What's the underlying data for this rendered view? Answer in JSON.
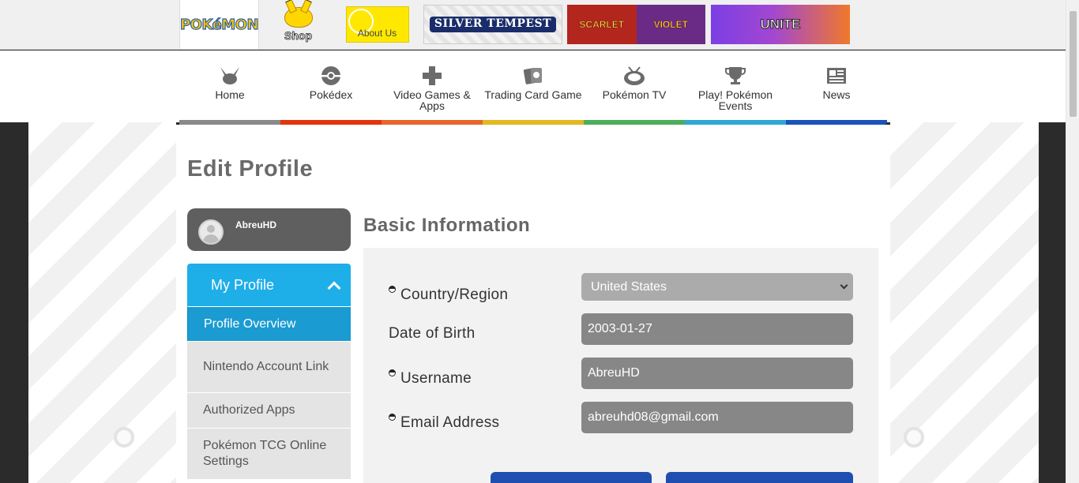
{
  "brand_bar": {
    "pokemon_logo": "POKéMON",
    "shop_label": "Shop",
    "about_label": "About Us",
    "banners": {
      "silver_tempest": "SILVER TEMPEST",
      "scarlet": "SCARLET",
      "violet": "VIOLET",
      "unite": "UNITE"
    }
  },
  "nav": {
    "items": [
      {
        "label": "Home",
        "icon": "pikachu-ears-icon",
        "color": "#8a8a8a"
      },
      {
        "label": "Pokédex",
        "icon": "pokeball-icon",
        "color": "#e3350d"
      },
      {
        "label": "Video Games & Apps",
        "icon": "dpad-icon",
        "color": "#e6672d"
      },
      {
        "label": "Trading Card Game",
        "icon": "cards-icon",
        "color": "#e2b921"
      },
      {
        "label": "Pokémon TV",
        "icon": "tv-icon",
        "color": "#4dad5b"
      },
      {
        "label": "Play! Pokémon Events",
        "icon": "trophy-icon",
        "color": "#30a7d7"
      },
      {
        "label": "News",
        "icon": "newspaper-icon",
        "color": "#1b53ba"
      }
    ]
  },
  "page": {
    "title": "Edit Profile"
  },
  "user": {
    "name": "AbreuHD"
  },
  "sidebar": {
    "heading": "My Profile",
    "items": [
      {
        "label": "Profile Overview",
        "active": true
      },
      {
        "label": "Nintendo Account Link",
        "active": false
      },
      {
        "label": "Authorized Apps",
        "active": false
      },
      {
        "label": "Pokémon TCG Online Settings",
        "active": false
      }
    ]
  },
  "basic_info": {
    "title": "Basic Information",
    "country_label": "Country/Region",
    "country_value": "United States",
    "dob_label": "Date of Birth",
    "dob_value": "2003-01-27",
    "username_label": "Username",
    "username_value": "AbreuHD",
    "email_label": "Email Address",
    "email_value": "abreuhd08@gmail.com"
  },
  "colors": {
    "accent": "#1eaee8",
    "active_item": "#1a9bd1",
    "button": "#1e4fb0"
  }
}
